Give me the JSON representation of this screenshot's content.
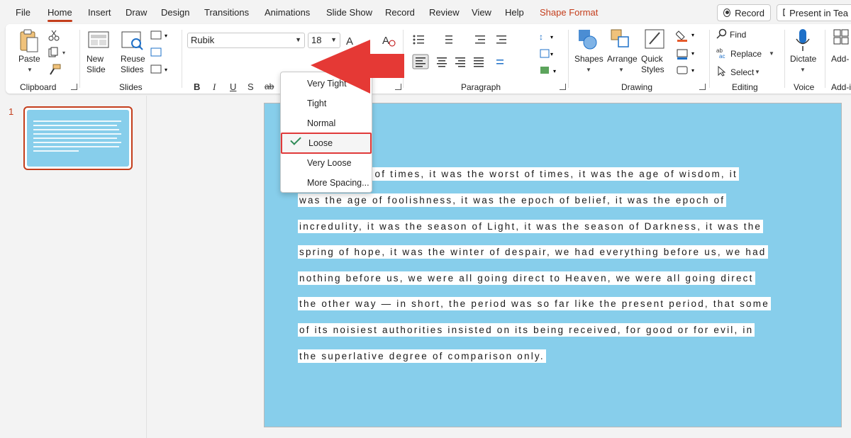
{
  "menu": {
    "tabs": [
      "File",
      "Home",
      "Insert",
      "Draw",
      "Design",
      "Transitions",
      "Animations",
      "Slide Show",
      "Record",
      "Review",
      "View",
      "Help",
      "Shape Format"
    ],
    "record_button": "Record",
    "present_button": "Present in Tea"
  },
  "ribbon": {
    "clipboard": {
      "label": "Clipboard",
      "paste": "Paste"
    },
    "slides": {
      "label": "Slides",
      "new_slide_1": "New",
      "new_slide_2": "Slide",
      "reuse_1": "Reuse",
      "reuse_2": "Slides"
    },
    "font": {
      "family": "Rubik",
      "size": "18",
      "bold": "B",
      "italic": "I",
      "underline": "U",
      "shadow": "S",
      "strike": "ab",
      "spacing": "AV"
    },
    "paragraph": {
      "label": "Paragraph"
    },
    "drawing": {
      "label": "Drawing",
      "shapes": "Shapes",
      "arrange": "Arrange",
      "quick_styles_1": "Quick",
      "quick_styles_2": "Styles"
    },
    "editing": {
      "label": "Editing",
      "find": "Find",
      "replace": "Replace",
      "select": "Select"
    },
    "voice": {
      "label": "Voice",
      "dictate": "Dictate"
    },
    "addins": {
      "label": "Add-i",
      "button": "Add-"
    }
  },
  "spacing_menu": {
    "items": [
      "Very Tight",
      "Tight",
      "Normal",
      "Loose",
      "Very Loose",
      "More Spacing..."
    ],
    "checked": "Loose"
  },
  "slide_panel": {
    "slide_number": "1"
  },
  "slide": {
    "lines": [
      "est of times, it was the worst of times, it was the age of wisdom, it",
      "was the age of foolishness, it was the epoch of belief, it was the epoch of",
      "incredulity, it was the season of Light, it was the season of Darkness, it was the",
      "spring of hope, it was the winter of despair, we had everything before us, we had",
      "nothing before us, we were all going direct to Heaven, we were all going direct",
      "the other way — in short, the period was so far like the present period, that some",
      "of its noisiest authorities insisted on its being received, for good or for evil, in",
      "the superlative degree of comparison only."
    ]
  },
  "colors": {
    "accent": "#c43e1c",
    "slide_bg": "#87ceeb",
    "arrow": "#e53935"
  }
}
